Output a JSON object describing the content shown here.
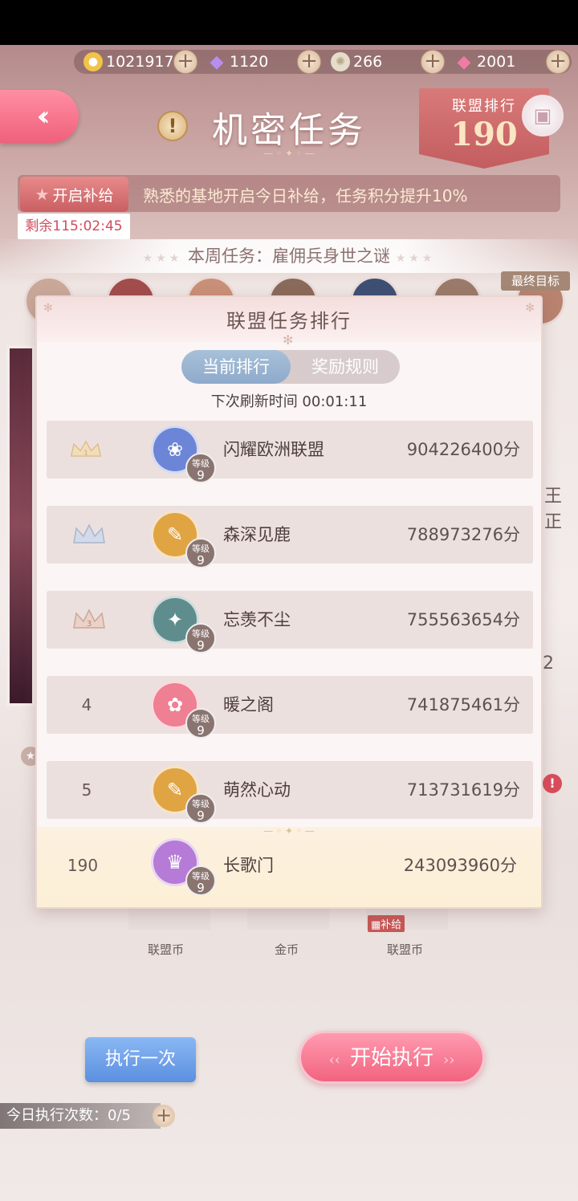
{
  "resources": [
    {
      "icon": "cat-coin-icon",
      "value": "1021917"
    },
    {
      "icon": "purple-diamond-icon",
      "value": "1120"
    },
    {
      "icon": "white-gem-icon",
      "value": "266"
    },
    {
      "icon": "pink-diamond-icon",
      "value": "2001"
    }
  ],
  "header": {
    "title": "机密任务",
    "rank_label": "联盟排行",
    "rank_value": "190"
  },
  "supply": {
    "button_label": "开启补给",
    "message": "熟悉的基地开启今日补给，任务积分提升10%",
    "remaining": "剩余115:02:45"
  },
  "week_task": "本周任务：雇佣兵身世之谜",
  "final_goal": "最终目标",
  "modal": {
    "title": "联盟任务排行",
    "tabs": [
      "当前排行",
      "奖励规则"
    ],
    "refresh": "下次刷新时间 00:01:11",
    "level_label": "等级",
    "rows": [
      {
        "rank": "1",
        "name": "闪耀欧洲联盟",
        "score": "904226400分",
        "level": "9",
        "color": "#6c85d6"
      },
      {
        "rank": "2",
        "name": "森深见鹿",
        "score": "788973276分",
        "level": "9",
        "color": "#e1a443"
      },
      {
        "rank": "3",
        "name": "忘羡不尘",
        "score": "755563654分",
        "level": "9",
        "color": "#5f8d8e"
      },
      {
        "rank": "4",
        "name": "暖之阁",
        "score": "741875461分",
        "level": "9",
        "color": "#ef7f92"
      },
      {
        "rank": "5",
        "name": "萌然心动",
        "score": "713731619分",
        "level": "9",
        "color": "#e1a443"
      }
    ],
    "own": {
      "rank": "190",
      "name": "长歌门",
      "score": "243093960分",
      "level": "9",
      "color": "#b67bd6"
    }
  },
  "bottom": {
    "labels": [
      "联盟币",
      "金币",
      "联盟币"
    ],
    "supply_tag": "补给",
    "side_text": [
      "王",
      "正",
      "2"
    ],
    "execute_once": "执行一次",
    "start_execute": "开始执行",
    "today_count": "今日执行次数：0/5"
  }
}
